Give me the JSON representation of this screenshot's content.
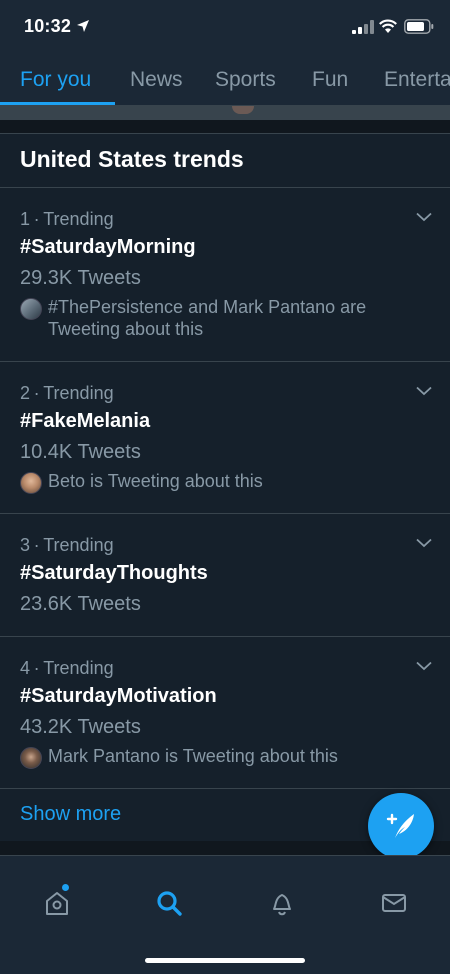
{
  "status_bar": {
    "time": "10:32"
  },
  "tabs": [
    {
      "label": "For you",
      "active": true
    },
    {
      "label": "News",
      "active": false
    },
    {
      "label": "Sports",
      "active": false
    },
    {
      "label": "Fun",
      "active": false
    },
    {
      "label": "Entertainment",
      "active": false
    }
  ],
  "section": {
    "title": "United States trends"
  },
  "trends": [
    {
      "rank": "1",
      "category": "Trending",
      "name": "#SaturdayMorning",
      "count": "29.3K Tweets",
      "context": "#ThePersistence and Mark Pantano are Tweeting about this"
    },
    {
      "rank": "2",
      "category": "Trending",
      "name": "#FakeMelania",
      "count": "10.4K Tweets",
      "context": "Beto is Tweeting about this"
    },
    {
      "rank": "3",
      "category": "Trending",
      "name": "#SaturdayThoughts",
      "count": "23.6K Tweets"
    },
    {
      "rank": "4",
      "category": "Trending",
      "name": "#SaturdayMotivation",
      "count": "43.2K Tweets",
      "context": "Mark Pantano is Tweeting about this"
    }
  ],
  "show_more": "Show more",
  "colors": {
    "accent": "#1da1f2",
    "background": "#15202b",
    "muted": "#8899a6",
    "divider": "#38444d"
  },
  "icons": {
    "compose": "compose-tweet-icon",
    "home": "home-icon",
    "search": "search-icon",
    "notifications": "bell-icon",
    "messages": "mail-icon"
  }
}
